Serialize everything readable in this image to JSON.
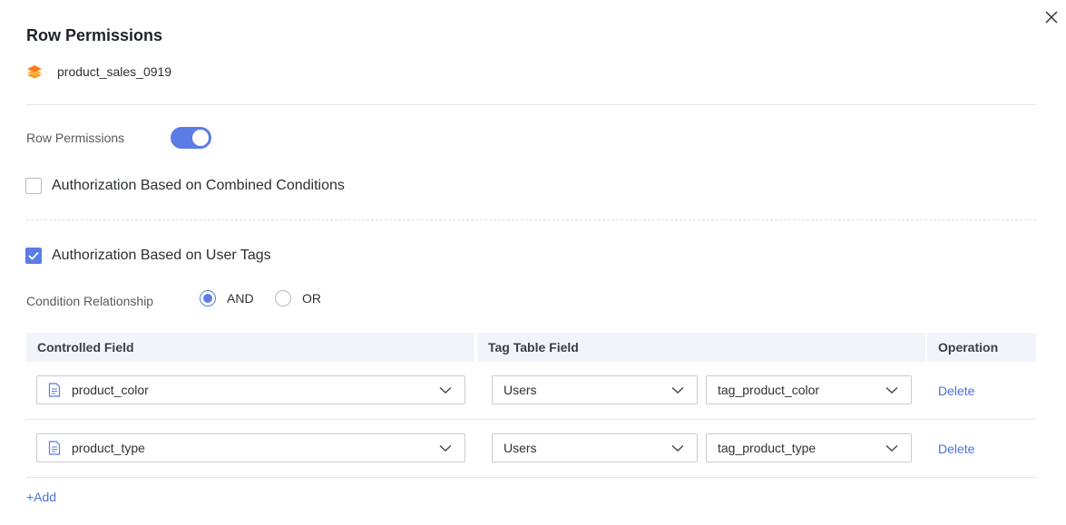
{
  "dialog": {
    "title": "Row Permissions",
    "dataset_name": "product_sales_0919",
    "dataset_icon": "layers-icon",
    "close_icon": "close-icon"
  },
  "row_permissions": {
    "label": "Row Permissions",
    "enabled": true
  },
  "combined_conditions": {
    "label": "Authorization Based on Combined Conditions",
    "checked": false
  },
  "user_tags": {
    "label": "Authorization Based on User Tags",
    "checked": true
  },
  "condition_relationship": {
    "label": "Condition Relationship",
    "options": [
      "AND",
      "OR"
    ],
    "selected": "AND"
  },
  "table": {
    "headers": [
      "Controlled Field",
      "Tag Table Field",
      "Operation"
    ],
    "rows": [
      {
        "controlled_field": "product_color",
        "tag_source": "Users",
        "tag_field": "tag_product_color",
        "operation": "Delete"
      },
      {
        "controlled_field": "product_type",
        "tag_source": "Users",
        "tag_field": "tag_product_type",
        "operation": "Delete"
      }
    ]
  },
  "add_label": "+Add",
  "colors": {
    "accent": "#5b7ce4",
    "link": "#4a72d6",
    "header_bg": "#f1f4fa"
  }
}
